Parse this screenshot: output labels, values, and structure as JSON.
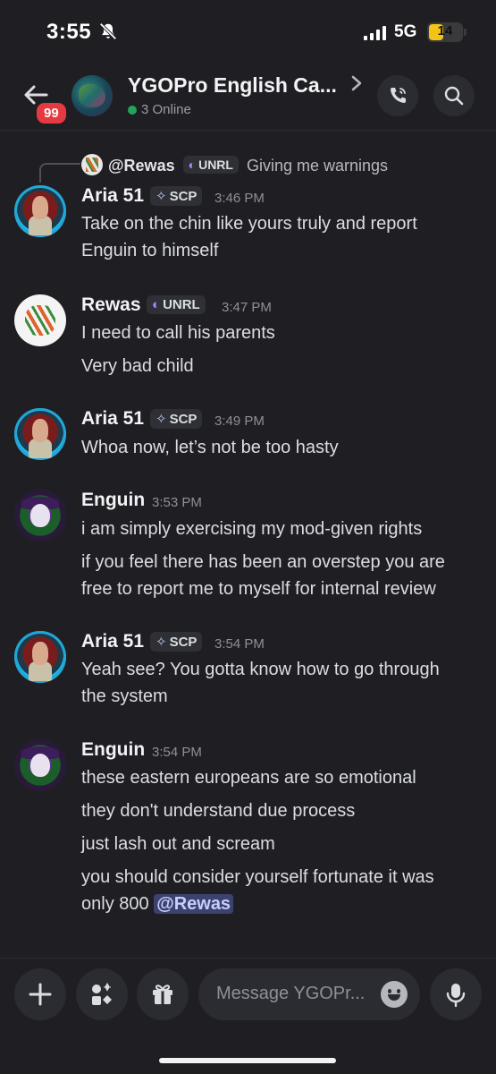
{
  "status_bar": {
    "time": "3:55",
    "network": "5G",
    "battery": "14"
  },
  "header": {
    "back_badge": "99",
    "title": "YGOPro English Ca...",
    "online": "3 Online"
  },
  "reply": {
    "author": "@Rewas",
    "author_tag": "UNRL",
    "text": "Giving me warnings"
  },
  "messages": [
    {
      "author": "Aria 51",
      "tag": "SCP",
      "time": "3:46 PM",
      "lines": [
        "Take on the chin like yours truly and report",
        "Enguin to himself"
      ]
    },
    {
      "author": "Rewas",
      "tag": "UNRL",
      "time": "3:47 PM",
      "lines": [
        "I need to call his parents",
        "Very bad child"
      ]
    },
    {
      "author": "Aria 51",
      "tag": "SCP",
      "time": "3:49 PM",
      "lines": [
        "Whoa now, let’s not be too hasty"
      ]
    },
    {
      "author": "Enguin",
      "tag": "",
      "time": "3:53 PM",
      "lines": [
        "i am simply exercising my mod-given rights",
        "if you feel there has been an overstep you are",
        "free to report me to myself for internal review"
      ]
    },
    {
      "author": "Aria 51",
      "tag": "SCP",
      "time": "3:54 PM",
      "lines": [
        "Yeah see? You gotta know how to go through",
        "the system"
      ]
    },
    {
      "author": "Enguin",
      "tag": "",
      "time": "3:54 PM",
      "lines": [
        "these eastern europeans are so emotional",
        "they don't understand due process",
        "just lash out and scream",
        "you should consider yourself fortunate it was",
        "only 800"
      ],
      "mention": "@Rewas"
    }
  ],
  "composer": {
    "placeholder": "Message YGOPr..."
  }
}
